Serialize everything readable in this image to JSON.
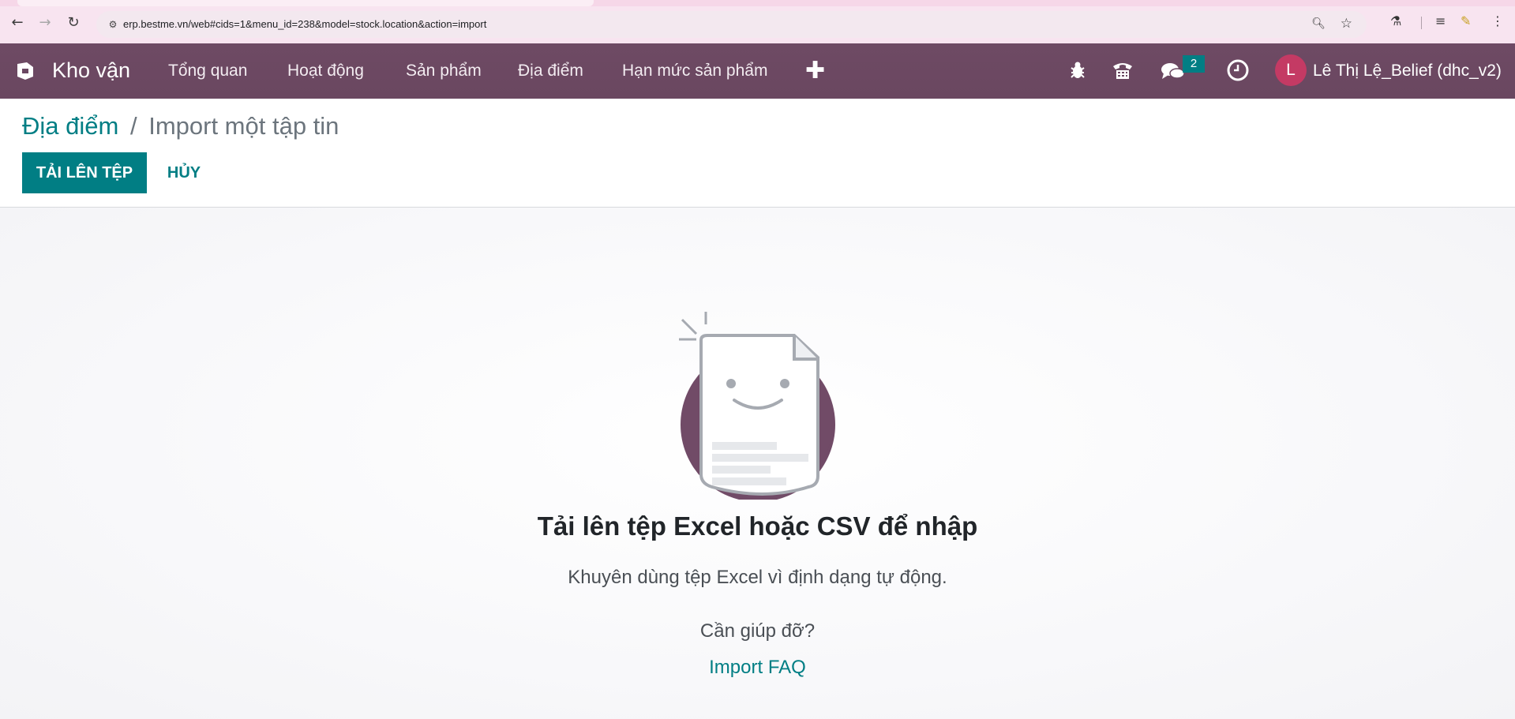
{
  "browser": {
    "url": "erp.bestme.vn/web#cids=1&menu_id=238&model=stock.location&action=import"
  },
  "navbar": {
    "app_name": "Kho vận",
    "menu": [
      {
        "label": "Tổng quan"
      },
      {
        "label": "Hoạt động"
      },
      {
        "label": "Sản phẩm"
      },
      {
        "label": "Địa điểm"
      },
      {
        "label": "Hạn mức sản phẩm"
      }
    ],
    "messages_badge": "2",
    "user_initial": "L",
    "user_name": "Lê Thị Lệ_Belief (dhc_v2)",
    "icons": [
      "bug-icon",
      "phone-icon",
      "chat-icon",
      "clock-icon"
    ]
  },
  "breadcrumb": {
    "parent": "Địa điểm",
    "separator": "/",
    "current": "Import một tập tin"
  },
  "actions": {
    "upload_label": "TẢI LÊN TỆP",
    "cancel_label": "HỦY"
  },
  "empty_state": {
    "title": "Tải lên tệp Excel hoặc CSV để nhập",
    "subtitle": "Khuyên dùng tệp Excel vì định dạng tự động.",
    "help_question": "Cần giúp đỡ?",
    "faq_link": "Import FAQ"
  },
  "colors": {
    "navbar": "#714b67",
    "primary": "#017e84",
    "avatar": "#c43a64"
  }
}
